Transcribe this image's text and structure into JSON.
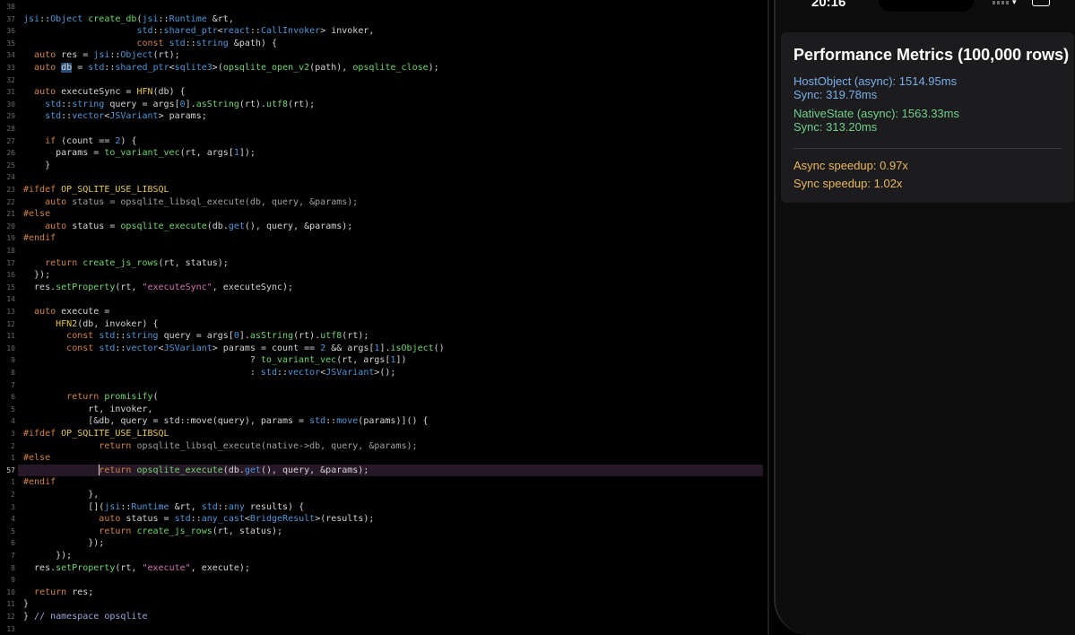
{
  "editor": {
    "lines": [
      {
        "n": "38",
        "t": [
          [
            "",
            ""
          ]
        ]
      },
      {
        "n": "37",
        "t": [
          [
            "t-type",
            "jsi"
          ],
          [
            "t-plain",
            "::"
          ],
          [
            "t-type",
            "Object"
          ],
          [
            "t-plain",
            " "
          ],
          [
            "t-fn",
            "create_db"
          ],
          [
            "t-plain",
            "("
          ],
          [
            "t-type",
            "jsi"
          ],
          [
            "t-plain",
            "::"
          ],
          [
            "t-type",
            "Runtime"
          ],
          [
            "t-plain",
            " &rt,"
          ]
        ]
      },
      {
        "n": "36",
        "t": [
          [
            "t-plain",
            "                     "
          ],
          [
            "t-type",
            "std"
          ],
          [
            "t-plain",
            "::"
          ],
          [
            "t-type",
            "shared_ptr"
          ],
          [
            "t-plain",
            "<"
          ],
          [
            "t-type",
            "react"
          ],
          [
            "t-plain",
            "::"
          ],
          [
            "t-type",
            "CallInvoker"
          ],
          [
            "t-plain",
            "> invoker,"
          ]
        ]
      },
      {
        "n": "35",
        "t": [
          [
            "t-plain",
            "                     "
          ],
          [
            "t-kw",
            "const"
          ],
          [
            "t-plain",
            " "
          ],
          [
            "t-type",
            "std"
          ],
          [
            "t-plain",
            "::"
          ],
          [
            "t-type",
            "string"
          ],
          [
            "t-plain",
            " &path) {"
          ]
        ]
      },
      {
        "n": "34",
        "t": [
          [
            "t-plain",
            "  "
          ],
          [
            "t-kw",
            "auto"
          ],
          [
            "t-plain",
            " res = "
          ],
          [
            "t-type",
            "jsi"
          ],
          [
            "t-plain",
            "::"
          ],
          [
            "t-type",
            "Object"
          ],
          [
            "t-plain",
            "(rt);"
          ]
        ]
      },
      {
        "n": "33",
        "t": [
          [
            "t-plain",
            "  "
          ],
          [
            "t-kw",
            "auto"
          ],
          [
            "t-plain",
            " "
          ],
          [
            "t-hl",
            "db"
          ],
          [
            "t-plain",
            " = "
          ],
          [
            "t-type",
            "std"
          ],
          [
            "t-plain",
            "::"
          ],
          [
            "t-type",
            "shared_ptr"
          ],
          [
            "t-plain",
            "<"
          ],
          [
            "t-type",
            "sqlite3"
          ],
          [
            "t-plain",
            ">("
          ],
          [
            "t-fn",
            "opsqlite_open_v2"
          ],
          [
            "t-plain",
            "(path), "
          ],
          [
            "t-fn",
            "opsqlite_close"
          ],
          [
            "t-plain",
            ");"
          ]
        ]
      },
      {
        "n": "32",
        "t": [
          [
            "",
            ""
          ]
        ]
      },
      {
        "n": "31",
        "t": [
          [
            "t-plain",
            "  "
          ],
          [
            "t-kw",
            "auto"
          ],
          [
            "t-plain",
            " executeSync = "
          ],
          [
            "t-mac",
            "HFN"
          ],
          [
            "t-plain",
            "(db) {"
          ]
        ]
      },
      {
        "n": "30",
        "t": [
          [
            "t-plain",
            "    "
          ],
          [
            "t-type",
            "std"
          ],
          [
            "t-plain",
            "::"
          ],
          [
            "t-type",
            "string"
          ],
          [
            "t-plain",
            " query = args["
          ],
          [
            "t-num",
            "0"
          ],
          [
            "t-plain",
            "]."
          ],
          [
            "t-fn",
            "asString"
          ],
          [
            "t-plain",
            "(rt)."
          ],
          [
            "t-fn",
            "utf8"
          ],
          [
            "t-plain",
            "(rt);"
          ]
        ]
      },
      {
        "n": "29",
        "t": [
          [
            "t-plain",
            "    "
          ],
          [
            "t-type",
            "std"
          ],
          [
            "t-plain",
            "::"
          ],
          [
            "t-type",
            "vector"
          ],
          [
            "t-plain",
            "<"
          ],
          [
            "t-type",
            "JSVariant"
          ],
          [
            "t-plain",
            "> params;"
          ]
        ]
      },
      {
        "n": "28",
        "t": [
          [
            "",
            ""
          ]
        ]
      },
      {
        "n": "27",
        "t": [
          [
            "t-plain",
            "    "
          ],
          [
            "t-kw",
            "if"
          ],
          [
            "t-plain",
            " (count == "
          ],
          [
            "t-num",
            "2"
          ],
          [
            "t-plain",
            ") {"
          ]
        ]
      },
      {
        "n": "26",
        "t": [
          [
            "t-plain",
            "      params = "
          ],
          [
            "t-fn",
            "to_variant_vec"
          ],
          [
            "t-plain",
            "(rt, args["
          ],
          [
            "t-num",
            "1"
          ],
          [
            "t-plain",
            "]);"
          ]
        ]
      },
      {
        "n": "25",
        "t": [
          [
            "t-plain",
            "    }"
          ]
        ]
      },
      {
        "n": "24",
        "t": [
          [
            "",
            ""
          ]
        ]
      },
      {
        "n": "23",
        "t": [
          [
            "t-pp",
            "#ifdef"
          ],
          [
            "t-plain",
            " "
          ],
          [
            "t-mac",
            "OP_SQLITE_USE_LIBSQL"
          ]
        ]
      },
      {
        "n": "22",
        "t": [
          [
            "t-gray",
            "    "
          ],
          [
            "t-kw",
            "auto"
          ],
          [
            "t-gray",
            " status = opsqlite_libsql_execute(db, query, &params);"
          ]
        ]
      },
      {
        "n": "21",
        "t": [
          [
            "t-pp",
            "#else"
          ]
        ]
      },
      {
        "n": "20",
        "t": [
          [
            "t-plain",
            "    "
          ],
          [
            "t-kw",
            "auto"
          ],
          [
            "t-plain",
            " status = "
          ],
          [
            "t-fn",
            "opsqlite_execute"
          ],
          [
            "t-plain",
            "(db."
          ],
          [
            "t-type",
            "get"
          ],
          [
            "t-plain",
            "(), query, &params);"
          ]
        ]
      },
      {
        "n": "19",
        "t": [
          [
            "t-pp",
            "#endif"
          ]
        ]
      },
      {
        "n": "18",
        "t": [
          [
            "",
            ""
          ]
        ]
      },
      {
        "n": "17",
        "t": [
          [
            "t-plain",
            "    "
          ],
          [
            "t-kw",
            "return"
          ],
          [
            "t-plain",
            " "
          ],
          [
            "t-fn",
            "create_js_rows"
          ],
          [
            "t-plain",
            "(rt, status);"
          ]
        ]
      },
      {
        "n": "16",
        "t": [
          [
            "t-plain",
            "  });"
          ]
        ]
      },
      {
        "n": "15",
        "t": [
          [
            "t-plain",
            "  res."
          ],
          [
            "t-fn",
            "setProperty"
          ],
          [
            "t-plain",
            "(rt, "
          ],
          [
            "t-str",
            "\"executeSync\""
          ],
          [
            "t-plain",
            ", executeSync);"
          ]
        ]
      },
      {
        "n": "14",
        "t": [
          [
            "",
            ""
          ]
        ]
      },
      {
        "n": "13",
        "t": [
          [
            "t-plain",
            "  "
          ],
          [
            "t-kw",
            "auto"
          ],
          [
            "t-plain",
            " execute ="
          ]
        ]
      },
      {
        "n": "12",
        "t": [
          [
            "t-plain",
            "      "
          ],
          [
            "t-mac",
            "HFN2"
          ],
          [
            "t-plain",
            "(db, invoker) {"
          ]
        ]
      },
      {
        "n": "11",
        "t": [
          [
            "t-plain",
            "        "
          ],
          [
            "t-kw",
            "const"
          ],
          [
            "t-plain",
            " "
          ],
          [
            "t-type",
            "std"
          ],
          [
            "t-plain",
            "::"
          ],
          [
            "t-type",
            "string"
          ],
          [
            "t-plain",
            " query = args["
          ],
          [
            "t-num",
            "0"
          ],
          [
            "t-plain",
            "]."
          ],
          [
            "t-fn",
            "asString"
          ],
          [
            "t-plain",
            "(rt)."
          ],
          [
            "t-fn",
            "utf8"
          ],
          [
            "t-plain",
            "(rt);"
          ]
        ]
      },
      {
        "n": "10",
        "t": [
          [
            "t-plain",
            "        "
          ],
          [
            "t-kw",
            "const"
          ],
          [
            "t-plain",
            " "
          ],
          [
            "t-type",
            "std"
          ],
          [
            "t-plain",
            "::"
          ],
          [
            "t-type",
            "vector"
          ],
          [
            "t-plain",
            "<"
          ],
          [
            "t-type",
            "JSVariant"
          ],
          [
            "t-plain",
            "> params = count == "
          ],
          [
            "t-num",
            "2"
          ],
          [
            "t-plain",
            " && args["
          ],
          [
            "t-num",
            "1"
          ],
          [
            "t-plain",
            "]."
          ],
          [
            "t-fn",
            "isObject"
          ],
          [
            "t-plain",
            "()"
          ]
        ]
      },
      {
        "n": "9",
        "t": [
          [
            "t-plain",
            "                                          ? "
          ],
          [
            "t-fn",
            "to_variant_vec"
          ],
          [
            "t-plain",
            "(rt, args["
          ],
          [
            "t-num",
            "1"
          ],
          [
            "t-plain",
            "])"
          ]
        ]
      },
      {
        "n": "8",
        "t": [
          [
            "t-plain",
            "                                          : "
          ],
          [
            "t-type",
            "std"
          ],
          [
            "t-plain",
            "::"
          ],
          [
            "t-type",
            "vector"
          ],
          [
            "t-plain",
            "<"
          ],
          [
            "t-type",
            "JSVariant"
          ],
          [
            "t-plain",
            ">();"
          ]
        ]
      },
      {
        "n": "7",
        "t": [
          [
            "",
            ""
          ]
        ]
      },
      {
        "n": "6",
        "t": [
          [
            "t-plain",
            "        "
          ],
          [
            "t-kw",
            "return"
          ],
          [
            "t-plain",
            " "
          ],
          [
            "t-fn",
            "promisify"
          ],
          [
            "t-plain",
            "("
          ]
        ]
      },
      {
        "n": "5",
        "t": [
          [
            "t-plain",
            "            rt, invoker,"
          ]
        ]
      },
      {
        "n": "4",
        "t": [
          [
            "t-plain",
            "            [&db, query = std::move(query), params = "
          ],
          [
            "t-type",
            "std"
          ],
          [
            "t-plain",
            "::"
          ],
          [
            "t-type",
            "move"
          ],
          [
            "t-plain",
            "(params)]() {"
          ]
        ]
      },
      {
        "n": "3",
        "t": [
          [
            "t-pp",
            "#ifdef"
          ],
          [
            "t-plain",
            " "
          ],
          [
            "t-mac",
            "OP_SQLITE_USE_LIBSQL"
          ]
        ]
      },
      {
        "n": "2",
        "t": [
          [
            "t-gray",
            "              "
          ],
          [
            "t-kw",
            "return"
          ],
          [
            "t-gray",
            " opsqlite_libsql_execute(native->db, query, &params);"
          ]
        ]
      },
      {
        "n": "1",
        "t": [
          [
            "t-pp",
            "#else"
          ]
        ]
      },
      {
        "n": "57",
        "current": true,
        "t": [
          [
            "t-plain",
            "              "
          ],
          [
            "caret",
            ""
          ],
          [
            "t-kw",
            "return"
          ],
          [
            "t-plain",
            " "
          ],
          [
            "t-fn",
            "opsqlite_execute"
          ],
          [
            "t-plain",
            "(db."
          ],
          [
            "t-type",
            "get"
          ],
          [
            "t-plain",
            "(), query, &params);"
          ]
        ]
      },
      {
        "n": "1",
        "t": [
          [
            "t-pp",
            "#endif"
          ]
        ]
      },
      {
        "n": "2",
        "t": [
          [
            "t-plain",
            "            },"
          ]
        ]
      },
      {
        "n": "3",
        "t": [
          [
            "t-plain",
            "            []("
          ],
          [
            "t-type",
            "jsi"
          ],
          [
            "t-plain",
            "::"
          ],
          [
            "t-type",
            "Runtime"
          ],
          [
            "t-plain",
            " &rt, "
          ],
          [
            "t-type",
            "std"
          ],
          [
            "t-plain",
            "::"
          ],
          [
            "t-type",
            "any"
          ],
          [
            "t-plain",
            " results) {"
          ]
        ]
      },
      {
        "n": "4",
        "t": [
          [
            "t-plain",
            "              "
          ],
          [
            "t-kw",
            "auto"
          ],
          [
            "t-plain",
            " status = "
          ],
          [
            "t-type",
            "std"
          ],
          [
            "t-plain",
            "::"
          ],
          [
            "t-type",
            "any_cast"
          ],
          [
            "t-plain",
            "<"
          ],
          [
            "t-type",
            "BridgeResult"
          ],
          [
            "t-plain",
            ">(results);"
          ]
        ]
      },
      {
        "n": "5",
        "t": [
          [
            "t-plain",
            "              "
          ],
          [
            "t-kw",
            "return"
          ],
          [
            "t-plain",
            " "
          ],
          [
            "t-fn",
            "create_js_rows"
          ],
          [
            "t-plain",
            "(rt, status);"
          ]
        ]
      },
      {
        "n": "6",
        "t": [
          [
            "t-plain",
            "            });"
          ]
        ]
      },
      {
        "n": "7",
        "t": [
          [
            "t-plain",
            "      });"
          ]
        ]
      },
      {
        "n": "8",
        "t": [
          [
            "t-plain",
            "  res."
          ],
          [
            "t-fn",
            "setProperty"
          ],
          [
            "t-plain",
            "(rt, "
          ],
          [
            "t-str",
            "\"execute\""
          ],
          [
            "t-plain",
            ", execute);"
          ]
        ]
      },
      {
        "n": "9",
        "t": [
          [
            "",
            ""
          ]
        ]
      },
      {
        "n": "10",
        "t": [
          [
            "t-plain",
            "  "
          ],
          [
            "t-kw",
            "return"
          ],
          [
            "t-plain",
            " res;"
          ]
        ]
      },
      {
        "n": "11",
        "t": [
          [
            "t-plain",
            "}"
          ]
        ]
      },
      {
        "n": "12",
        "t": [
          [
            "t-plain",
            "} "
          ],
          [
            "t-cm",
            "// namespace opsqlite"
          ]
        ]
      },
      {
        "n": "13",
        "t": [
          [
            "",
            ""
          ]
        ]
      }
    ]
  },
  "phone": {
    "status_bar": {
      "time": "20:16"
    },
    "card": {
      "title": "Performance Metrics (100,000 rows)",
      "host_object_async": "HostObject (async): 1514.95ms",
      "host_object_sync": "Sync: 319.78ms",
      "native_state_async": "NativeState (async): 1563.33ms",
      "native_state_sync": "Sync: 313.20ms",
      "async_speedup": "Async speedup: 0.97x",
      "sync_speedup": "Sync speedup: 1.02x"
    }
  }
}
